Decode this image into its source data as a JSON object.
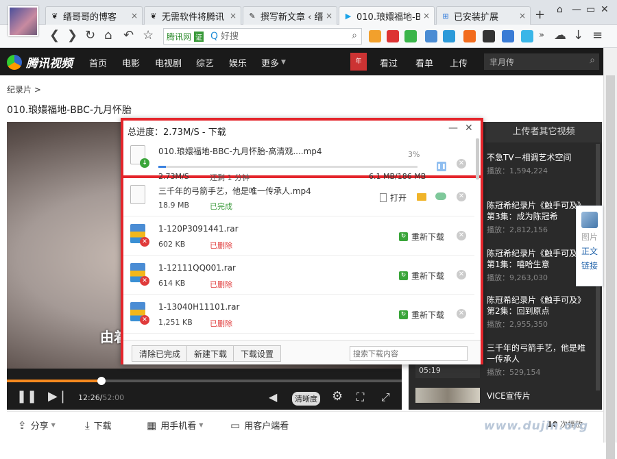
{
  "browser": {
    "tabs": [
      {
        "title": "缙哥哥的博客",
        "icon": "❦",
        "active": false
      },
      {
        "title": "无需软件将腾讯",
        "icon": "❦",
        "active": false
      },
      {
        "title": "撰写新文章 ‹ 缙",
        "icon": "✎",
        "active": false
      },
      {
        "title": "010.琅嬛福地-B",
        "icon": "▶",
        "active": true
      },
      {
        "title": "已安装扩展",
        "icon": "⊞",
        "active": false
      }
    ],
    "new_tab": "+",
    "address": {
      "site": "腾讯网",
      "verified": "证",
      "placeholder": "好搜"
    },
    "tab_close": "×"
  },
  "site": {
    "logo": "腾讯视频",
    "nav": [
      "首页",
      "电影",
      "电视剧",
      "综艺",
      "娱乐",
      "更多"
    ],
    "right_nav": [
      "看过",
      "看单",
      "上传"
    ],
    "user_badge": "年",
    "search_text": "芈月传"
  },
  "page": {
    "breadcrumb": "纪录片 >",
    "title": "010.琅嬛福地-BBC-九月怀胎"
  },
  "player": {
    "subtitle": "由着",
    "current_time": "12:26",
    "total_time": "52:00",
    "clarity": "清晰度",
    "progress": 0.24
  },
  "side": {
    "header": "上传者其它视频",
    "videos": [
      {
        "title": "不急TV－相调艺术空间",
        "plays": "播放：1,594,224"
      },
      {
        "title": "陈冠希纪录片《触手可及》第3集：成为陈冠希",
        "plays": "播放：2,812,156"
      },
      {
        "title": "陈冠希纪录片《触手可及》第1集：嘻哈生意",
        "plays": "播放：9,263,030"
      },
      {
        "title": "陈冠希纪录片《触手可及》第2集：回到原点",
        "plays": "播放：2,955,350"
      },
      {
        "title": "三千年的弓箭手艺，他是唯一传承人",
        "plays": "播放：529,154"
      }
    ],
    "thumb_time": "05:19",
    "last_title": "VICE宣传片"
  },
  "floatbox": {
    "pic": "图片",
    "text": "正文",
    "link": "链接"
  },
  "bottom": {
    "share": "分享",
    "download": "下载",
    "mobile": "用手机看",
    "client": "用客户端看",
    "plays_num": "10",
    "plays_label": "次播放"
  },
  "watermark": "www.dujin.org",
  "downloader": {
    "title": "总进度：2.73M/S - 下载",
    "active": {
      "file": "010.琅嬛福地-BBC-九月怀胎-高清观....mp4",
      "percent_label": "3%",
      "progress": 0.03,
      "speed": "2.73M/S",
      "remaining": "还剩 1 分钟",
      "sizes": "6.1 MB/186 MB"
    },
    "items": [
      {
        "file": "三千年的弓箭手艺，他是唯一传承人.mp4",
        "size": "18.9 MB",
        "status": "已完成",
        "action": "打开"
      },
      {
        "file": "1-120P3091441.rar",
        "size": "602 KB",
        "status": "已删除",
        "action": "重新下载"
      },
      {
        "file": "1-12111QQ001.rar",
        "size": "614 KB",
        "status": "已删除",
        "action": "重新下载"
      },
      {
        "file": "1-13040H11101.rar",
        "size": "1,251 KB",
        "status": "已删除",
        "action": "重新下载"
      }
    ],
    "footer": {
      "clear": "清除已完成",
      "new": "新建下载",
      "settings": "下载设置",
      "search_placeholder": "搜索下载内容"
    }
  },
  "colors": {
    "highlight": "#e4252b",
    "progress": "#f5891f",
    "ok": "#3aa53a",
    "deleted": "#e03b3b"
  }
}
